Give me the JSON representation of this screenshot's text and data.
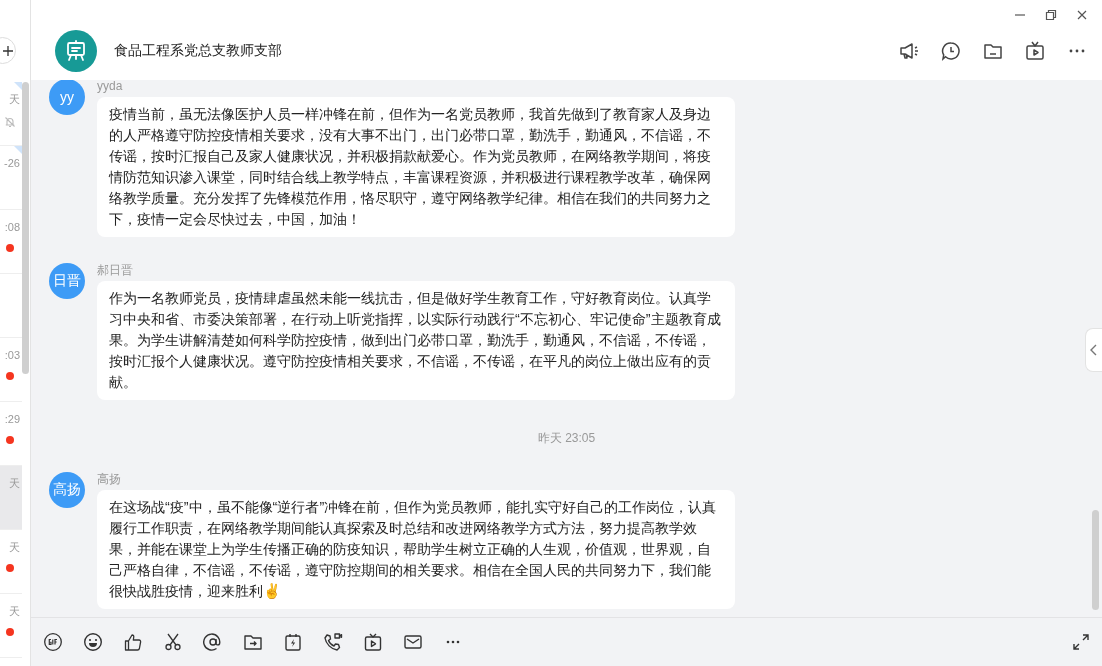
{
  "sidebar": {
    "items": [
      {
        "time": "天",
        "pinned": true,
        "muted": true,
        "unread": false,
        "selected": false
      },
      {
        "time": "-26",
        "pinned": true,
        "muted": false,
        "unread": false,
        "selected": false
      },
      {
        "time": ":08",
        "pinned": false,
        "muted": false,
        "unread": true,
        "selected": false
      },
      {
        "pinned": false,
        "muted": false,
        "unread": false,
        "selected": false
      },
      {
        "time": ":03",
        "pinned": false,
        "muted": false,
        "unread": true,
        "selected": false
      },
      {
        "time": ":29",
        "pinned": false,
        "muted": false,
        "unread": true,
        "selected": false
      },
      {
        "time": "天",
        "pinned": false,
        "muted": false,
        "unread": false,
        "selected": true
      },
      {
        "time": "天",
        "pinned": false,
        "muted": false,
        "unread": true,
        "selected": false
      },
      {
        "time": "天",
        "pinned": false,
        "muted": false,
        "unread": true,
        "selected": false
      }
    ]
  },
  "header": {
    "title": "食品工程系党总支教师支部"
  },
  "messages": [
    {
      "kind": "message",
      "avatar": "yy",
      "sender": "yyda",
      "text": "疫情当前，虽无法像医护人员一样冲锋在前，但作为一名党员教师，我首先做到了教育家人及身边的人严格遵守防控疫情相关要求，没有大事不出门，出门必带口罩，勤洗手，勤通风，不信谣，不传谣，按时汇报自己及家人健康状况，并积极捐款献爱心。作为党员教师，在网络教学期间，将疫情防范知识渗入课堂，同时结合线上教学特点，丰富课程资源，并积极进行课程教学改革，确保网络教学质量。充分发挥了先锋模范作用，恪尽职守，遵守网络教学纪律。相信在我们的共同努力之下，疫情一定会尽快过去，中国，加油！"
    },
    {
      "kind": "message",
      "avatar": "日晋",
      "sender": "郝日晋",
      "text": "作为一名教师党员，疫情肆虐虽然未能一线抗击，但是做好学生教育工作，守好教育岗位。认真学习中央和省、市委决策部署，在行动上听党指挥，以实际行动践行“不忘初心、牢记使命”主题教育成果。为学生讲解清楚如何科学防控疫情，做到出门必带口罩，勤洗手，勤通风，不信谣，不传谣，按时汇报个人健康状况。遵守防控疫情相关要求，不信谣，不传谣，在平凡的岗位上做出应有的贡献。"
    },
    {
      "kind": "time",
      "text": "昨天 23:05"
    },
    {
      "kind": "message",
      "avatar": "高扬",
      "sender": "高扬",
      "text": "在这场战“疫”中，虽不能像“逆行者”冲锋在前，但作为党员教师，能扎实守好自己的工作岗位，认真履行工作职责，在网络教学期间能认真探索及时总结和改进网络教学方式方法，努力提高教学效果，并能在课堂上为学生传播正确的防疫知识，帮助学生树立正确的人生观，价值观，世界观，自己严格自律，不信谣，不传谣，遵守防控期间的相关要求。相信在全国人民的共同努力下，我们能很快战胜疫情，迎来胜利✌"
    }
  ]
}
